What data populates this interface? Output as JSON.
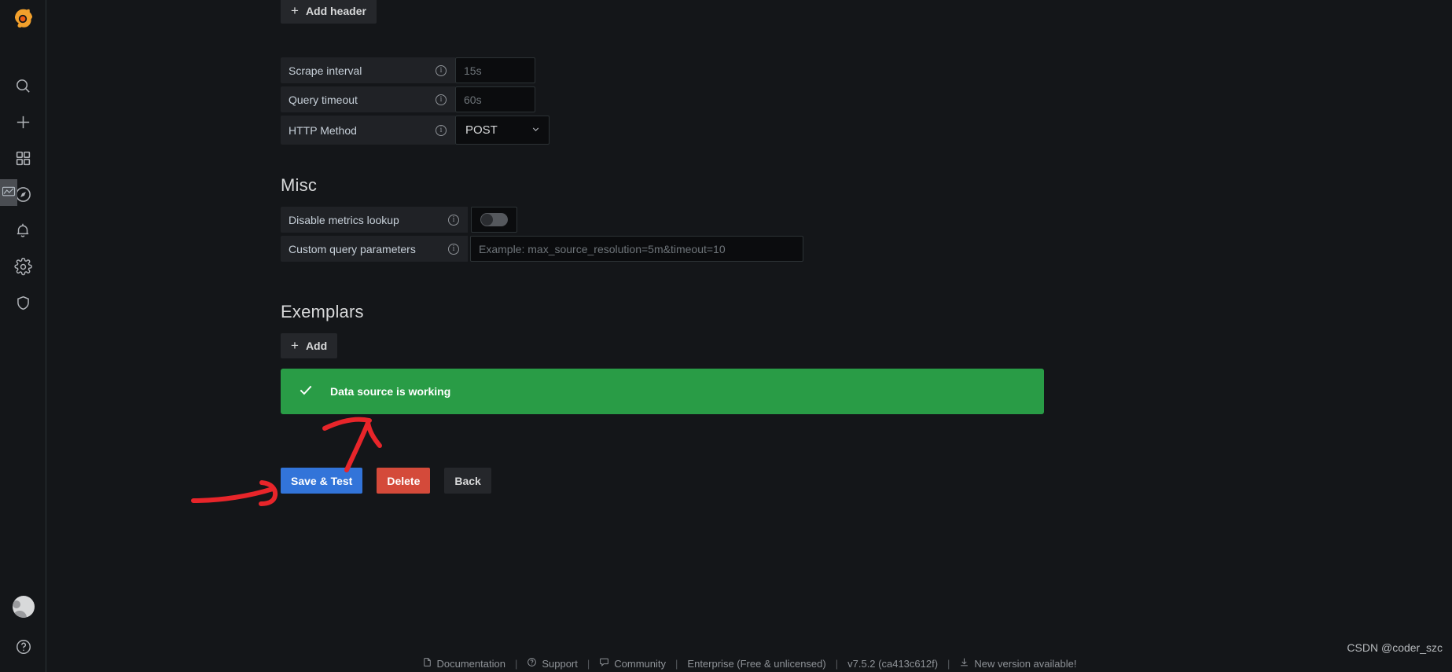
{
  "sidebar": {
    "logo": "grafana-logo",
    "items": [
      {
        "icon": "search-icon",
        "name": "search"
      },
      {
        "icon": "plus-icon",
        "name": "create"
      },
      {
        "icon": "dashboards-icon",
        "name": "dashboards"
      },
      {
        "icon": "compass-icon",
        "name": "explore"
      },
      {
        "icon": "bell-icon",
        "name": "alerting"
      },
      {
        "icon": "gear-icon",
        "name": "configuration"
      },
      {
        "icon": "shield-icon",
        "name": "server-admin"
      }
    ],
    "avatar": "user-avatar",
    "help": "help-icon"
  },
  "form": {
    "add_header_label": "Add header",
    "rows": [
      {
        "label": "Scrape interval",
        "value": "",
        "placeholder": "15s",
        "type": "input"
      },
      {
        "label": "Query timeout",
        "value": "",
        "placeholder": "60s",
        "type": "input"
      },
      {
        "label": "HTTP Method",
        "value": "POST",
        "type": "select"
      }
    ]
  },
  "misc": {
    "title": "Misc",
    "disable_metrics_lookup_label": "Disable metrics lookup",
    "disable_metrics_lookup_value": "off",
    "custom_query_parameters_label": "Custom query parameters",
    "custom_query_parameters_value": "",
    "custom_query_parameters_placeholder": "Example: max_source_resolution=5m&timeout=10"
  },
  "exemplars": {
    "title": "Exemplars",
    "add_label": "Add"
  },
  "alert": {
    "icon": "check-icon",
    "message": "Data source is working",
    "color": "#299c46"
  },
  "actions": {
    "save_label": "Save & Test",
    "delete_label": "Delete",
    "back_label": "Back",
    "save_color": "#3274d9",
    "delete_color": "#d44a3a"
  },
  "annotations": {
    "color": "#e8252a",
    "arrow_to_alert": "red-arrow-pointing-to-alert",
    "arrow_to_save": "red-arrow-pointing-to-save-button"
  },
  "footer": {
    "links": [
      {
        "label": "Documentation",
        "icon": "doc-icon"
      },
      {
        "label": "Support",
        "icon": "question-circle-icon"
      },
      {
        "label": "Community",
        "icon": "comment-icon"
      }
    ],
    "edition": "Enterprise (Free & unlicensed)",
    "version": "v7.5.2 (ca413c612f)",
    "update": {
      "label": "New version available!",
      "icon": "download-icon"
    },
    "separator": "|"
  },
  "watermark": "CSDN @coder_szc"
}
